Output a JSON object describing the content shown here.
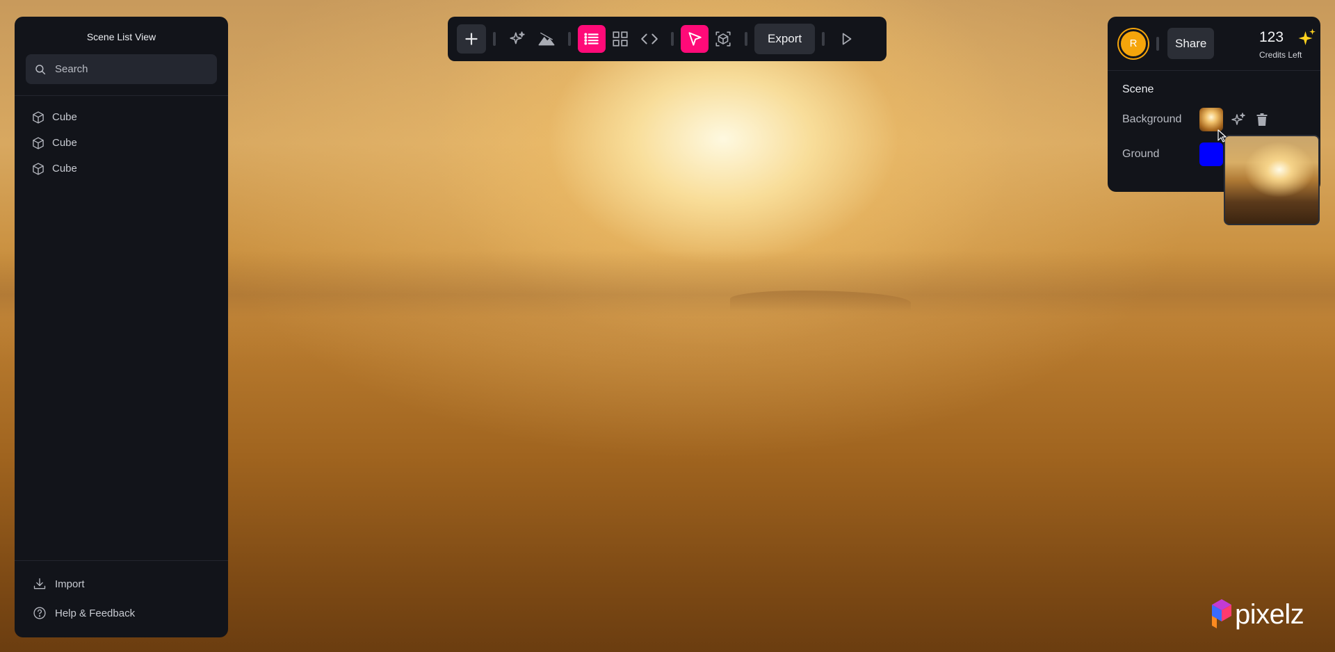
{
  "left_panel": {
    "title": "Scene List View",
    "search_placeholder": "Search",
    "items": [
      {
        "label": "Cube",
        "icon": "cube-icon"
      },
      {
        "label": "Cube",
        "icon": "cube-icon"
      },
      {
        "label": "Cube",
        "icon": "cube-icon"
      }
    ],
    "import_label": "Import",
    "help_label": "Help & Feedback"
  },
  "toolbar": {
    "icons": [
      "plus-icon",
      "sparkle-icon",
      "terrain-icon",
      "list-icon",
      "grid-icon",
      "code-icon",
      "select-arrow-icon",
      "box-transform-icon",
      "play-icon"
    ],
    "export_label": "Export"
  },
  "right_panel": {
    "avatar_initial": "R",
    "share_label": "Share",
    "credits": "123",
    "credits_label": "Credits Left",
    "scene_title": "Scene",
    "background_label": "Background",
    "ground_label": "Ground",
    "ground_color": "#0000ff"
  },
  "colors": {
    "accent": "#ff0a78",
    "panel": "#12141a",
    "avatar": "#f5a50b"
  },
  "logo": {
    "text": "pixelz"
  }
}
